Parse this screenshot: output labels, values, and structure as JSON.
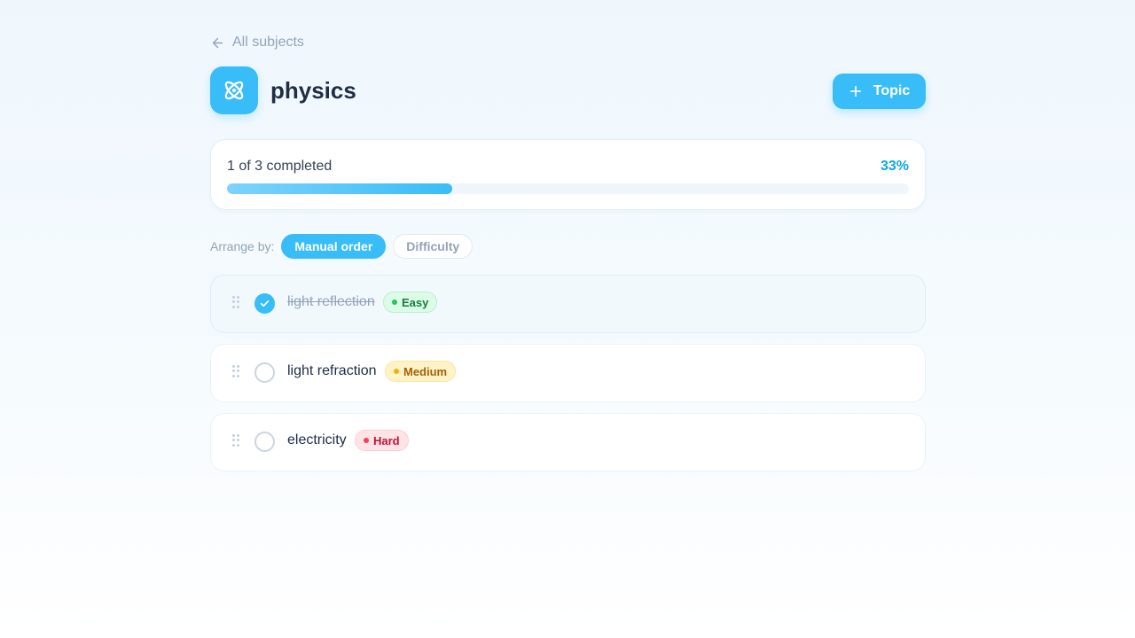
{
  "nav": {
    "back_label": "All subjects"
  },
  "subject": {
    "title": "physics",
    "icon": "atom-icon",
    "accent": "#38bdf8"
  },
  "toolbar": {
    "add_label": "Topic"
  },
  "progress": {
    "label": "1 of 3 completed",
    "percent_label": "33%",
    "completed": 1,
    "total": 3,
    "fraction": 0.33
  },
  "arrange": {
    "label": "Arrange by:",
    "options": [
      {
        "label": "Manual order",
        "active": true
      },
      {
        "label": "Difficulty",
        "active": false
      }
    ]
  },
  "topics": [
    {
      "name": "light reflection",
      "difficulty": "Easy",
      "completed": true
    },
    {
      "name": "light refraction",
      "difficulty": "Medium",
      "completed": false
    },
    {
      "name": "electricity",
      "difficulty": "Hard",
      "completed": false
    }
  ],
  "colors": {
    "easy": "#22c55e",
    "medium": "#eab308",
    "hard": "#f43f5e"
  }
}
